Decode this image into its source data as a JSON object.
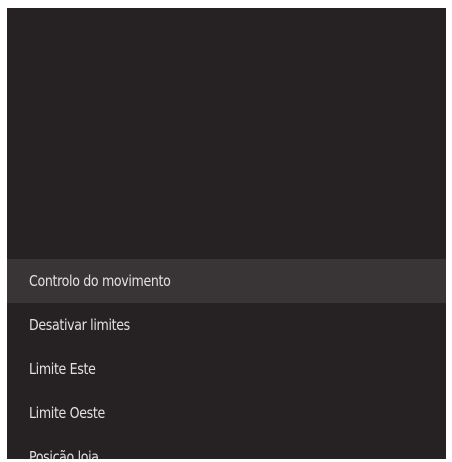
{
  "menu": {
    "items": [
      {
        "label": "Controlo do movimento"
      },
      {
        "label": "Desativar limites"
      },
      {
        "label": "Limite Este"
      },
      {
        "label": "Limite Oeste"
      },
      {
        "label": "Posição loja"
      }
    ],
    "selected_index": 0
  },
  "colors": {
    "panel_background": "#262122",
    "selected_background": "#393536",
    "text": "#e3e1e1"
  }
}
